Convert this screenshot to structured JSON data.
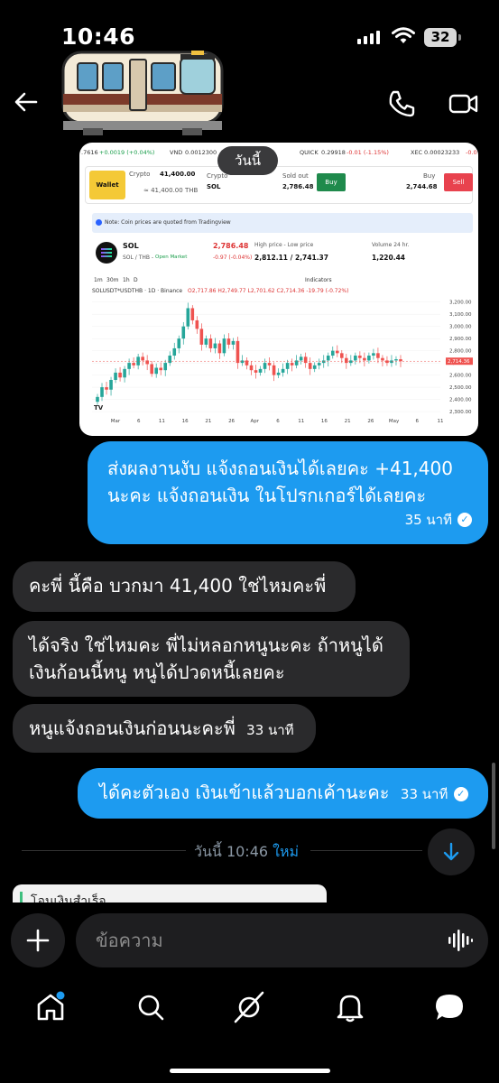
{
  "status_bar": {
    "time": "10:46",
    "battery": "32"
  },
  "header": {
    "back_label": "back",
    "call_label": "call",
    "video_label": "video call"
  },
  "image": {
    "date_pill": "วันนี้",
    "ticker": [
      {
        "text": ".7616",
        "color": "dark"
      },
      {
        "text": "+0.0019 (+0.04%)",
        "color": "green"
      },
      {
        "text": "VND",
        "color": "dark"
      },
      {
        "text": "0.0012300",
        "color": "dark"
      },
      {
        "text": "QUICK",
        "color": "dark"
      },
      {
        "text": "0.29918",
        "color": "dark"
      },
      {
        "text": "-0.01 (-1.15%)",
        "color": "red"
      },
      {
        "text": "XEC",
        "color": "dark"
      },
      {
        "text": "0.00023233",
        "color": "dark"
      },
      {
        "text": "-0.0",
        "color": "red"
      }
    ],
    "wallet_label": "Wallet",
    "crypto_label": "Crypto",
    "crypto_amount": "41,400.00",
    "crypto_thb": "≈ 41,400.00 THB",
    "crypto_label_2": "Crypto",
    "crypto_symbol": "SOL",
    "sold_out_label": "Sold out",
    "sold_out_price": "2,786.48",
    "buy_btn": "Buy",
    "buy_label": "Buy",
    "buy_price": "2,744.68",
    "sell_btn": "Sell",
    "note": "Note: Coin prices are quoted from Tradingview",
    "pair_name": "SOL",
    "pair_sub": "SOL / THB -",
    "market_status": "Open Market",
    "price": "2,786.48",
    "price_change": "-0.97 (-0.04%)",
    "hl_label": "High price - Low price",
    "hl_value": "2,812.11 / 2,741.37",
    "vol_label": "Volume 24 hr.",
    "vol_value": "1,220.44",
    "tf": [
      "1m",
      "30m",
      "1h",
      "D"
    ],
    "indicators": "Indicators",
    "chart_symbol": "SOLUSDT*USDTHB · 1D · Binance",
    "ohlc": "O2,717.86 H2,749.77 L2,701.62 C2,714.36 -19.79 (-0.72%)",
    "last_price_tag": "2,714.36"
  },
  "chart_data": {
    "type": "candlestick",
    "x_ticks": [
      "Mar",
      "6",
      "11",
      "16",
      "21",
      "26",
      "Apr",
      "6",
      "11",
      "16",
      "21",
      "26",
      "May",
      "6",
      "11"
    ],
    "y_ticks": [
      "3,200.00",
      "3,100.00",
      "3,000.00",
      "2,900.00",
      "2,800.00",
      "2,700.00",
      "2,600.00",
      "2,500.00",
      "2,400.00",
      "2,300.00"
    ],
    "ylim": [
      2300,
      3250
    ],
    "closes": [
      2420,
      2500,
      2480,
      2560,
      2620,
      2580,
      2650,
      2700,
      2680,
      2750,
      2720,
      2690,
      2610,
      2660,
      2640,
      2700,
      2760,
      2820,
      2900,
      3000,
      3150,
      3050,
      2980,
      2850,
      2900,
      2820,
      2860,
      2780,
      2900,
      2850,
      2880,
      2700,
      2720,
      2680,
      2640,
      2620,
      2650,
      2700,
      2680,
      2600,
      2620,
      2650,
      2700,
      2680,
      2720,
      2750,
      2700,
      2650,
      2680,
      2700,
      2720,
      2760,
      2800,
      2780,
      2740,
      2700,
      2720,
      2760,
      2740,
      2720,
      2760,
      2780,
      2740,
      2720,
      2700,
      2720,
      2730,
      2714
    ]
  },
  "messages": [
    {
      "text": "ส่งผลงานงับ แจ้งถอนเงินได้เลยคะ +41,400 นะคะ แจ้งถอนเงิน ในโปรกเกอร์ได้เลยคะ",
      "time": "35 นาที"
    },
    {
      "text": "คะพี่ นี้คือ บวกมา 41,400 ใช่ไหมคะพี่"
    },
    {
      "text": "ได้จริง ใช่ไหมคะ พี่ไม่หลอกหนูนะคะ ถ้าหนูได้ เงินก้อนนี้หนู หนูได้ปวดหนี้เลยคะ"
    },
    {
      "text": "หนูแจ้งถอนเงินก่อนนะคะพี่",
      "time": "33 นาที"
    },
    {
      "text": "ได้คะตัวเอง เงินเข้าแล้วบอกเค้านะคะ",
      "time": "33 นาที"
    }
  ],
  "divider": {
    "text": "วันนี้ 10:46",
    "new": "ใหม่"
  },
  "card_preview": "โอนเงินสำเร็จ",
  "composer": {
    "placeholder": "ข้อความ"
  },
  "nav": [
    "home",
    "search",
    "grok",
    "notifications",
    "messages"
  ],
  "colors": {
    "accent": "#1d9bf0",
    "incoming": "#2a2a2c",
    "bg": "#000000"
  }
}
